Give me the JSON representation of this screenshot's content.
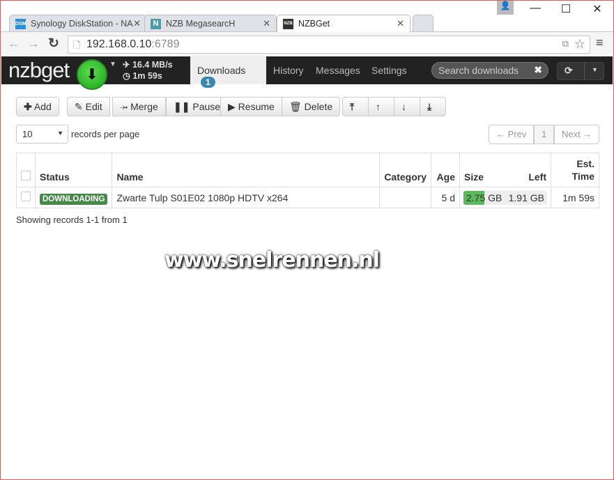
{
  "browser": {
    "tabs": [
      {
        "title": "Synology DiskStation - NA",
        "icon": "DSM"
      },
      {
        "title": "NZB MegasearcH",
        "icon": "N"
      },
      {
        "title": "NZBGet",
        "icon": "NZB"
      }
    ],
    "url_host": "192.168.0.10",
    "url_port": ":6789"
  },
  "app": {
    "brand": "nzbget",
    "speed": "16.4 MB/s",
    "time_left": "1m 59s",
    "nav": [
      {
        "label": "Downloads",
        "badge": "1"
      },
      {
        "label": "History"
      },
      {
        "label": "Messages"
      },
      {
        "label": "Settings"
      }
    ],
    "search_placeholder": "Search downloads"
  },
  "toolbar": {
    "add": "Add",
    "edit": "Edit",
    "merge": "Merge",
    "pause": "Pause",
    "resume": "Resume",
    "delete": "Delete"
  },
  "paging": {
    "page_size": "10",
    "records_per_page": "records per page",
    "prev": "← Prev",
    "page": "1",
    "next": "Next →"
  },
  "table": {
    "headers": {
      "status": "Status",
      "name": "Name",
      "category": "Category",
      "age": "Age",
      "size": "Size",
      "left": "Left",
      "est1": "Est.",
      "est2": "Time"
    },
    "rows": [
      {
        "status": "DOWNLOADING",
        "name": "Zwarte Tulp S01E02 1080p HDTV x264",
        "category": "",
        "age": "5 d",
        "size": "2.75 GB",
        "left": "1.91 GB",
        "est": "1m 59s",
        "progress": 0.25
      }
    ]
  },
  "footer": "Showing records 1-1 from 1",
  "watermark": "www.snelrennen.nl",
  "colors": {
    "accent": "#3a87ad",
    "downloading": "#468847",
    "progress": "#5cb85c"
  }
}
